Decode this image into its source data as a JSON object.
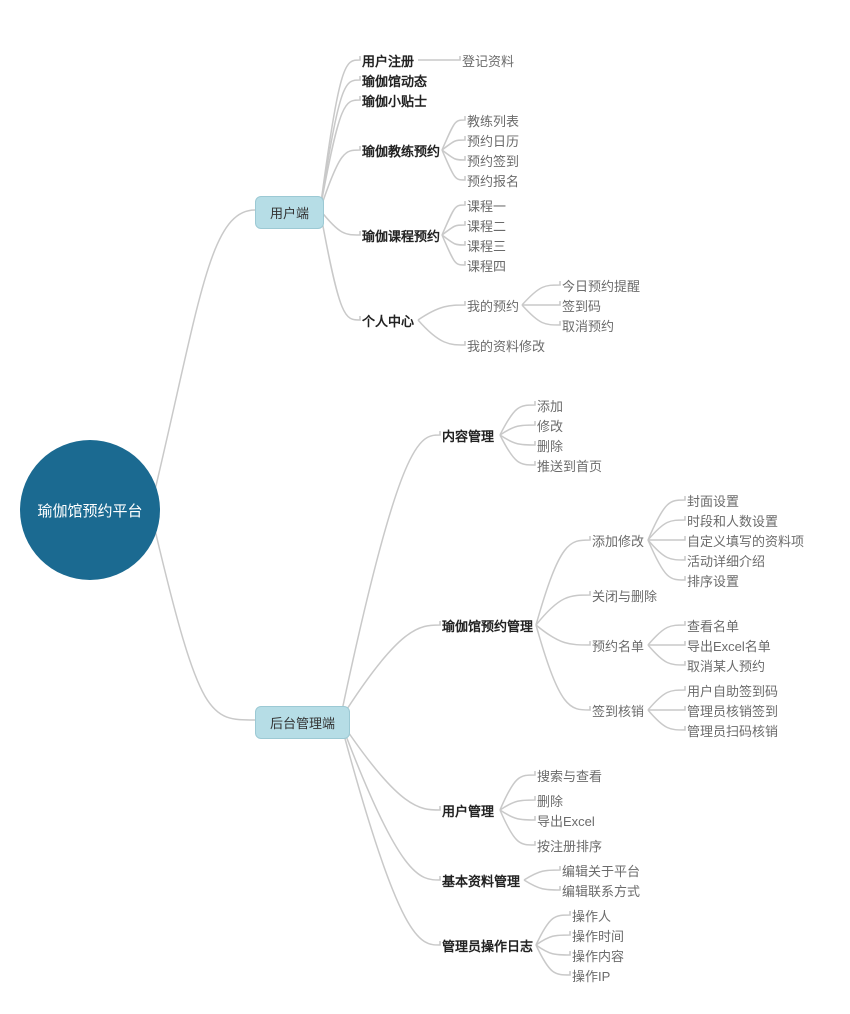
{
  "root": "瑜伽馆预约平台",
  "branch1": "用户端",
  "branch2": "后台管理端",
  "b1": {
    "n1": "用户注册",
    "n1c1": "登记资料",
    "n2": "瑜伽馆动态",
    "n3": "瑜伽小贴士",
    "n4": "瑜伽教练预约",
    "n4c1": "教练列表",
    "n4c2": "预约日历",
    "n4c3": "预约签到",
    "n4c4": "预约报名",
    "n5": "瑜伽课程预约",
    "n5c1": "课程一",
    "n5c2": "课程二",
    "n5c3": "课程三",
    "n5c4": "课程四",
    "n6": "个人中心",
    "n6c1": "我的预约",
    "n6c1c1": "今日预约提醒",
    "n6c1c2": "签到码",
    "n6c1c3": "取消预约",
    "n6c2": "我的资料修改"
  },
  "b2": {
    "n1": "内容管理",
    "n1c1": "添加",
    "n1c2": "修改",
    "n1c3": "删除",
    "n1c4": "推送到首页",
    "n2": "瑜伽馆预约管理",
    "n2c1": "添加修改",
    "n2c1c1": "封面设置",
    "n2c1c2": "时段和人数设置",
    "n2c1c3": "自定义填写的资料项",
    "n2c1c4": "活动详细介绍",
    "n2c1c5": "排序设置",
    "n2c2": "关闭与删除",
    "n2c3": "预约名单",
    "n2c3c1": "查看名单",
    "n2c3c2": "导出Excel名单",
    "n2c3c3": "取消某人预约",
    "n2c4": "签到核销",
    "n2c4c1": "用户自助签到码",
    "n2c4c2": "管理员核销签到",
    "n2c4c3": "管理员扫码核销",
    "n3": "用户管理",
    "n3c1": "搜索与查看",
    "n3c2": "删除",
    "n3c3": "导出Excel",
    "n3c4": "按注册排序",
    "n4": "基本资料管理",
    "n4c1": "编辑关于平台",
    "n4c2": "编辑联系方式",
    "n5": "管理员操作日志",
    "n5c1": "操作人",
    "n5c2": "操作时间",
    "n5c3": "操作内容",
    "n5c4": "操作IP"
  }
}
